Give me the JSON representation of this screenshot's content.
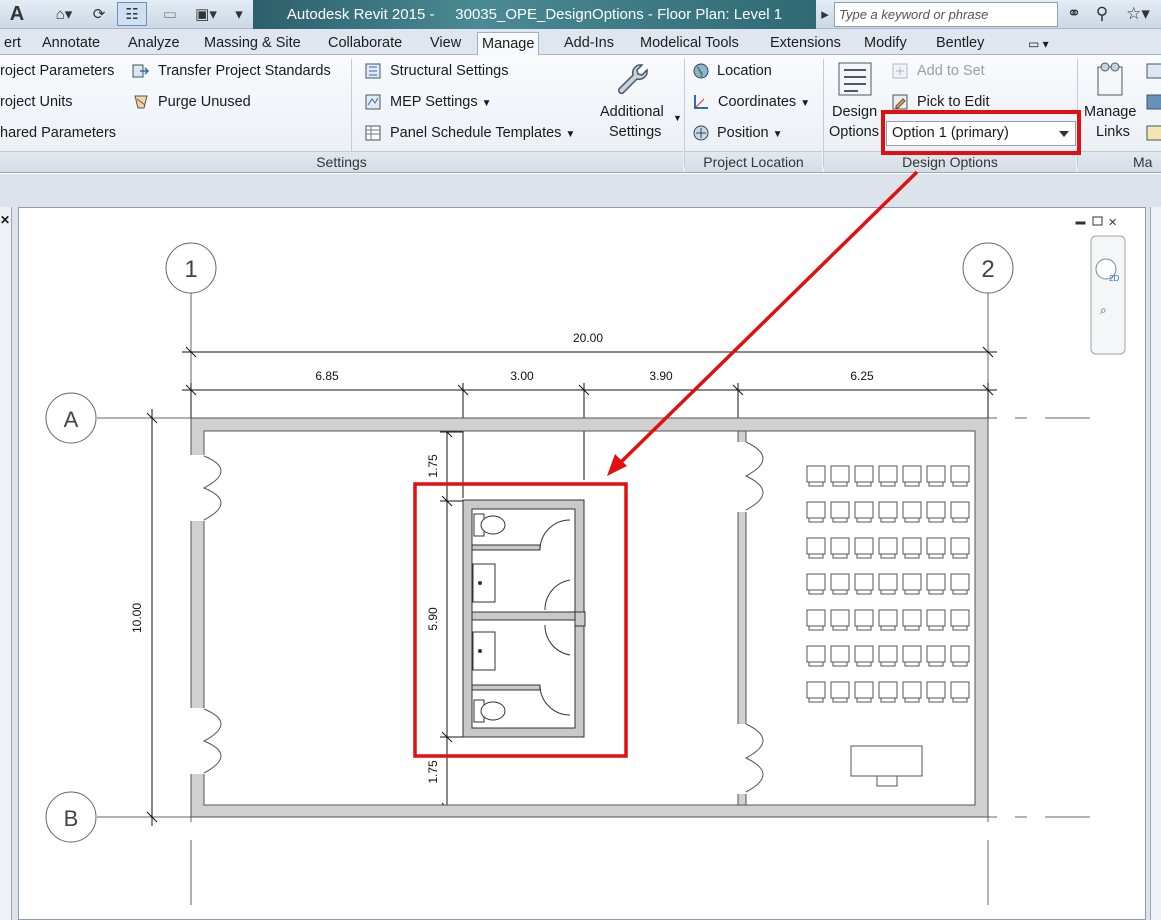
{
  "app": {
    "title": "Autodesk Revit 2015 -     30035_OPE_DesignOptions - Floor Plan: Level 1",
    "search_placeholder": "Type a keyword or phrase",
    "menu_letter": "A"
  },
  "tabs": [
    "ert",
    "Annotate",
    "Analyze",
    "Massing & Site",
    "Collaborate",
    "View",
    "Manage",
    "Add-Ins",
    "Modelical Tools",
    "Extensions",
    "Modify",
    "Bentley"
  ],
  "active_tab": "Manage",
  "ribbon": {
    "settings": {
      "project_parameters": "roject  Parameters",
      "project_units": "roject  Units",
      "shared_parameters": "hared  Parameters",
      "transfer_standards": "Transfer  Project Standards",
      "purge_unused": "Purge  Unused",
      "structural_settings": "Structural  Settings",
      "mep_settings": "MEP  Settings",
      "panel_schedule_templates": "Panel Schedule  Templates",
      "additional_settings_1": "Additional",
      "additional_settings_2": "Settings",
      "panel_label": "Settings"
    },
    "project_location": {
      "location": "Location",
      "coordinates": "Coordinates",
      "position": "Position",
      "panel_label": "Project Location"
    },
    "design_options": {
      "design_options_1": "Design",
      "design_options_2": "Options",
      "add_to_set": "Add to Set",
      "pick_to_edit": "Pick to Edit",
      "selected_option": "Option 1 (primary)",
      "panel_label": "Design Options"
    },
    "manage_links": {
      "label_1": "Manage",
      "label_2": "Links",
      "panel_label": "Ma"
    }
  },
  "plan": {
    "grid_labels": {
      "g1": "1",
      "g2": "2",
      "gA": "A",
      "gB": "B"
    },
    "dims": {
      "overall": "20.00",
      "seg1": "6.85",
      "seg2": "3.00",
      "seg3": "3.90",
      "seg4": "6.25",
      "height": "10.00",
      "top_offset": "1.75",
      "core": "5.90",
      "bottom_offset": "1.75"
    }
  },
  "colors": {
    "highlight": "#e01010",
    "title_bar": "#2c5f6b"
  }
}
